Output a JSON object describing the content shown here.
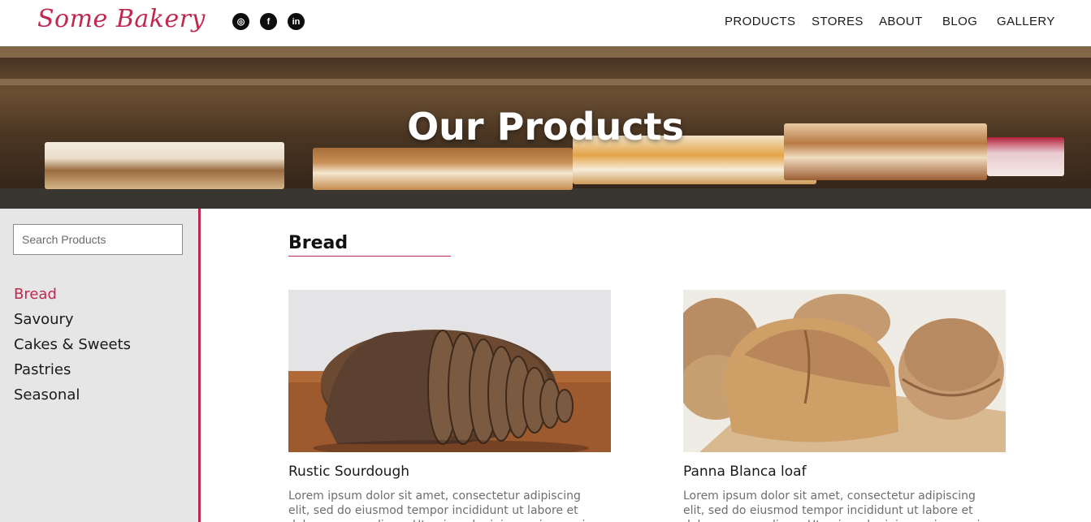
{
  "brand": {
    "name": "Some Bakery",
    "color": "#c0284f"
  },
  "social": [
    {
      "icon": "instagram-icon",
      "glyph": "◎"
    },
    {
      "icon": "facebook-icon",
      "glyph": "f"
    },
    {
      "icon": "linkedin-icon",
      "glyph": "in"
    }
  ],
  "nav": [
    "PRODUCTS",
    "STORES",
    "ABOUT",
    "BLOG",
    "GALLERY"
  ],
  "hero": {
    "title": "Our Products"
  },
  "sidebar": {
    "search_placeholder": "Search Products",
    "categories": [
      "Bread",
      "Savoury",
      "Cakes & Sweets",
      "Pastries",
      "Seasonal"
    ],
    "active_category": "Bread"
  },
  "section": {
    "title": "Bread"
  },
  "products": [
    {
      "name": "Rustic Sourdough",
      "description": "Lorem ipsum dolor sit amet, consectetur adipiscing elit, sed do eiusmod tempor incididunt ut labore et dolore magna aliqua. Ut enim ad minim veniam, quis"
    },
    {
      "name": "Panna Blanca loaf",
      "description": "Lorem ipsum dolor sit amet, consectetur adipiscing elit, sed do eiusmod tempor incididunt ut labore et dolore magna aliqua. Ut enim ad minim veniam, quis"
    }
  ]
}
